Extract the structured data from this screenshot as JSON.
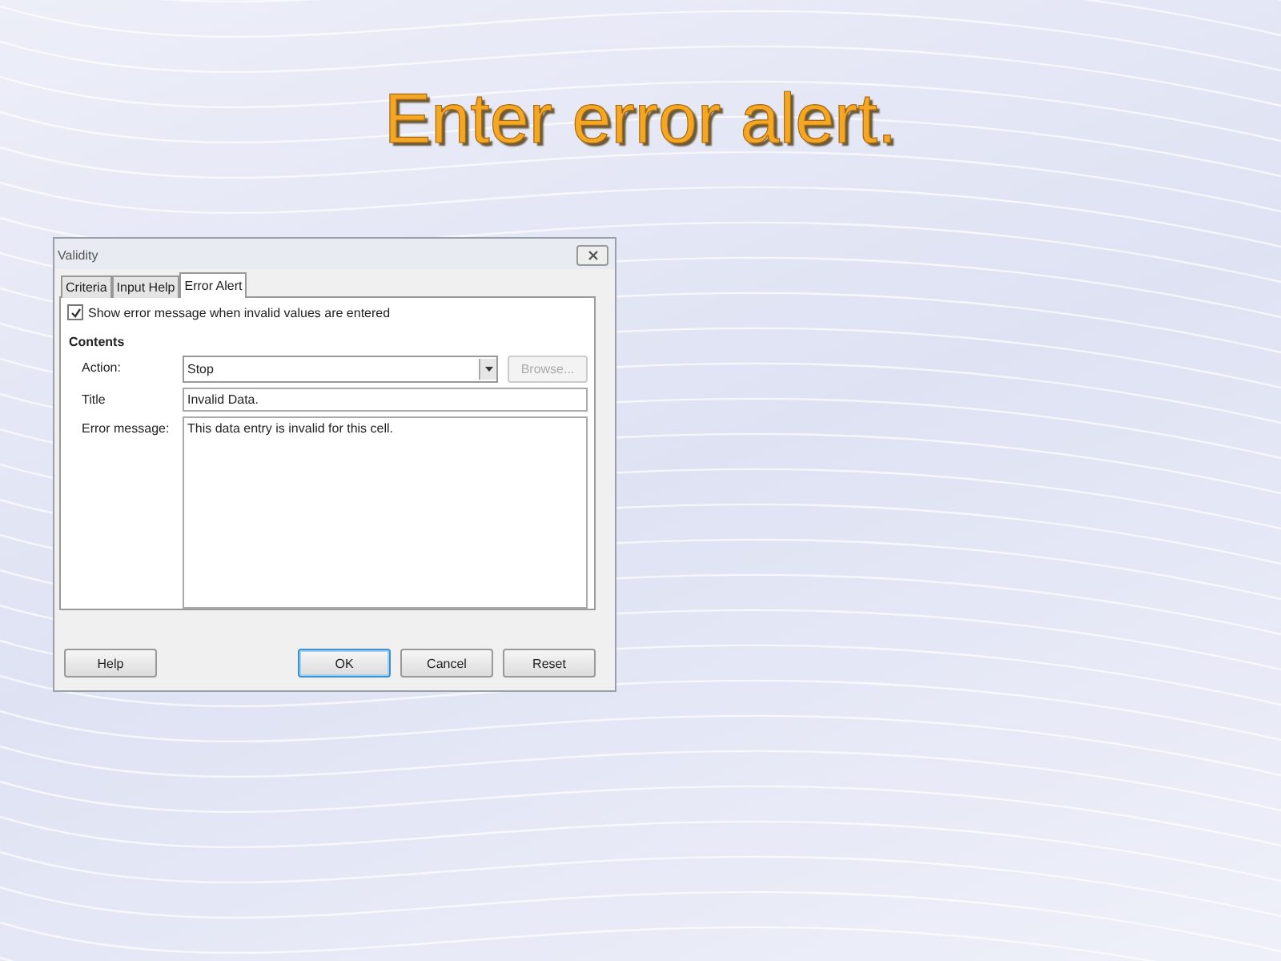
{
  "slide": {
    "title": "Enter error alert."
  },
  "dialog": {
    "title": "Validity",
    "tabs": [
      {
        "label": "Criteria",
        "selected": false
      },
      {
        "label": "Input Help",
        "selected": false
      },
      {
        "label": "Error Alert",
        "selected": true
      }
    ],
    "show_error": {
      "label": "Show error message when invalid values are entered",
      "checked": true
    },
    "section": "Contents",
    "action": {
      "label": "Action:",
      "value": "Stop"
    },
    "browse": {
      "label": "Browse...",
      "disabled": true
    },
    "title_field": {
      "label": "Title",
      "value": "Invalid Data."
    },
    "message_field": {
      "label": "Error message:",
      "value": "This data entry is invalid for this cell."
    },
    "buttons": [
      {
        "label": "Help",
        "default": false
      },
      {
        "label": "OK",
        "default": true
      },
      {
        "label": "Cancel",
        "default": false
      },
      {
        "label": "Reset",
        "default": false
      }
    ]
  }
}
